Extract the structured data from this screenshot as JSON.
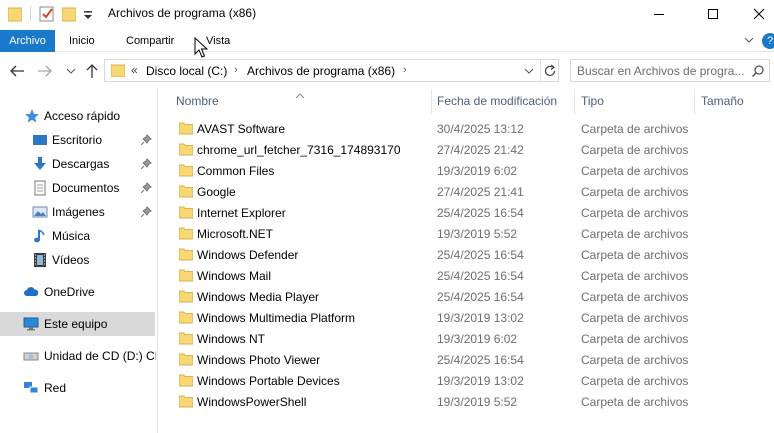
{
  "window": {
    "title": "Archivos de programa (x86)",
    "controls": {
      "minimize_icon": "minimize-icon",
      "maximize_icon": "maximize-icon",
      "close_icon": "close-icon"
    }
  },
  "quick_access_toolbar": {
    "icons": [
      "folder-icon",
      "properties-check-icon",
      "new-folder-icon",
      "customize-down-icon"
    ]
  },
  "ribbon": {
    "tabs": [
      {
        "label": "Archivo",
        "active": true
      },
      {
        "label": "Inicio"
      },
      {
        "label": "Compartir"
      },
      {
        "label": "Vista"
      }
    ],
    "help_label": "?"
  },
  "address_bar": {
    "overflow": "«",
    "segments": [
      "Disco local (C:)",
      "Archivos de programa (x86)"
    ],
    "separator": "›"
  },
  "search": {
    "placeholder": "Buscar en Archivos de progra..."
  },
  "sidebar": {
    "items": [
      {
        "label": "Acceso rápido",
        "icon": "star-icon"
      },
      {
        "label": "Escritorio",
        "icon": "desktop-icon",
        "pinned": true
      },
      {
        "label": "Descargas",
        "icon": "download-icon",
        "pinned": true
      },
      {
        "label": "Documentos",
        "icon": "documents-icon",
        "pinned": true
      },
      {
        "label": "Imágenes",
        "icon": "pictures-icon",
        "pinned": true
      },
      {
        "label": "Música",
        "icon": "music-icon"
      },
      {
        "label": "Vídeos",
        "icon": "videos-icon"
      },
      {
        "label": "OneDrive",
        "icon": "cloud-icon"
      },
      {
        "label": "Este equipo",
        "icon": "computer-icon",
        "selected": true
      },
      {
        "label": "Unidad de CD (D:) CE",
        "icon": "cd-drive-icon"
      },
      {
        "label": "Red",
        "icon": "network-icon"
      }
    ]
  },
  "file_list": {
    "columns": [
      "Nombre",
      "Fecha de modificación",
      "Tipo",
      "Tamaño"
    ],
    "rows": [
      {
        "name": "AVAST Software",
        "date": "30/4/2025 13:12",
        "type": "Carpeta de archivos"
      },
      {
        "name": "chrome_url_fetcher_7316_174893170",
        "date": "27/4/2025 21:42",
        "type": "Carpeta de archivos"
      },
      {
        "name": "Common Files",
        "date": "19/3/2019 6:02",
        "type": "Carpeta de archivos"
      },
      {
        "name": "Google",
        "date": "27/4/2025 21:41",
        "type": "Carpeta de archivos"
      },
      {
        "name": "Internet Explorer",
        "date": "25/4/2025 16:54",
        "type": "Carpeta de archivos"
      },
      {
        "name": "Microsoft.NET",
        "date": "19/3/2019 5:52",
        "type": "Carpeta de archivos"
      },
      {
        "name": "Windows Defender",
        "date": "25/4/2025 16:54",
        "type": "Carpeta de archivos"
      },
      {
        "name": "Windows Mail",
        "date": "25/4/2025 16:54",
        "type": "Carpeta de archivos"
      },
      {
        "name": "Windows Media Player",
        "date": "25/4/2025 16:54",
        "type": "Carpeta de archivos"
      },
      {
        "name": "Windows Multimedia Platform",
        "date": "19/3/2019 13:02",
        "type": "Carpeta de archivos"
      },
      {
        "name": "Windows NT",
        "date": "19/3/2019 6:02",
        "type": "Carpeta de archivos"
      },
      {
        "name": "Windows Photo Viewer",
        "date": "25/4/2025 16:54",
        "type": "Carpeta de archivos"
      },
      {
        "name": "Windows Portable Devices",
        "date": "19/3/2019 13:02",
        "type": "Carpeta de archivos"
      },
      {
        "name": "WindowsPowerShell",
        "date": "19/3/2019 5:52",
        "type": "Carpeta de archivos"
      }
    ]
  },
  "colors": {
    "accent": "#1979ca",
    "folder": "#f8d775",
    "header_text": "#4c607a",
    "selected_bg": "#d9d9d9"
  }
}
